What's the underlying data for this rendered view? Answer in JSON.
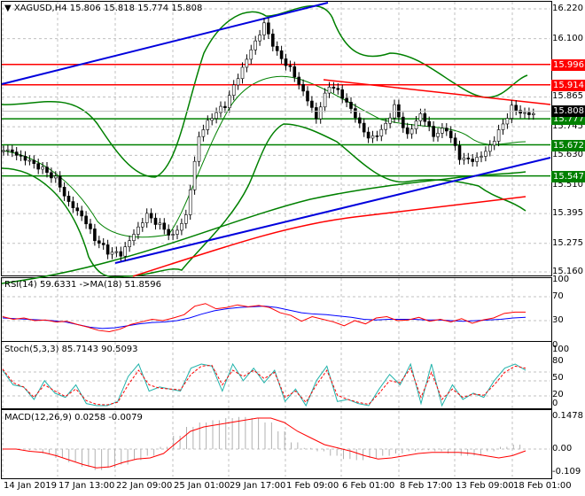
{
  "header": {
    "symbol": "XAGUSD,H4",
    "open": "15.806",
    "high": "15.818",
    "low": "15.774",
    "close": "15.808"
  },
  "price_axis": [
    "16.220",
    "16.100",
    "15.865",
    "15.745",
    "15.630",
    "15.510",
    "15.395",
    "15.275",
    "15.160"
  ],
  "levels": [
    {
      "label": "15.996",
      "price": 15.996,
      "color": "#ff0000"
    },
    {
      "label": "15.914",
      "price": 15.914,
      "color": "#ff0000"
    },
    {
      "label": "15.777",
      "price": 15.777,
      "color": "#008000"
    },
    {
      "label": "15.672",
      "price": 15.672,
      "color": "#008000"
    },
    {
      "label": "15.547",
      "price": 15.547,
      "color": "#008000"
    }
  ],
  "current_price": "15.808",
  "closes": [
    15.649,
    15.62,
    15.595,
    15.57,
    15.542,
    15.45,
    15.399,
    15.3,
    15.239,
    15.221,
    15.3,
    15.381,
    15.346,
    15.31,
    15.399,
    15.72,
    15.792,
    15.827,
    15.934,
    16.042,
    16.149,
    16.042,
    15.988,
    15.899,
    15.792,
    15.917,
    15.863,
    15.774,
    15.685,
    15.72,
    15.827,
    15.72,
    15.81,
    15.72,
    15.738,
    15.613,
    15.595,
    15.631,
    15.72,
    15.827,
    15.808
  ],
  "rsi": {
    "title": "RSI(14) 59.6331  ->MA(18) 51.8596",
    "axis": [
      "100",
      "70",
      "30",
      "0"
    ],
    "rsi": [
      52,
      48,
      50,
      46,
      47,
      44,
      45,
      40,
      36,
      31,
      29,
      33,
      40,
      44,
      48,
      46,
      50,
      55,
      68,
      72,
      64,
      66,
      70,
      67,
      69,
      66,
      58,
      54,
      45,
      52,
      48,
      44,
      38,
      46,
      41,
      50,
      52,
      46,
      47,
      51,
      45,
      48,
      44,
      49,
      42,
      47,
      50,
      57,
      59,
      59
    ],
    "ma": [
      50,
      49,
      48,
      47,
      46,
      44,
      40,
      36,
      34,
      35,
      38,
      41,
      43,
      44,
      46,
      50,
      56,
      61,
      64,
      66,
      67,
      68,
      66,
      62,
      58,
      56,
      55,
      53,
      51,
      48,
      47,
      48,
      48,
      48,
      47,
      47,
      46,
      45,
      46,
      47,
      48,
      50,
      51
    ]
  },
  "stoch": {
    "title": "Stoch(5,3,3) 85.7143 90.5093",
    "axis": [
      "100",
      "80",
      "50",
      "20",
      "0"
    ],
    "k": [
      85,
      50,
      45,
      15,
      60,
      30,
      20,
      50,
      5,
      0,
      0,
      10,
      70,
      100,
      35,
      45,
      40,
      35,
      90,
      100,
      95,
      35,
      100,
      60,
      90,
      55,
      85,
      10,
      40,
      0,
      60,
      95,
      10,
      15,
      5,
      0,
      40,
      75,
      50,
      100,
      5,
      100,
      0,
      50,
      15,
      30,
      20,
      60,
      90,
      100,
      85
    ],
    "d": [
      88,
      55,
      45,
      20,
      50,
      35,
      22,
      40,
      12,
      3,
      2,
      8,
      50,
      85,
      50,
      42,
      40,
      38,
      75,
      95,
      97,
      50,
      85,
      70,
      85,
      65,
      80,
      20,
      35,
      8,
      50,
      85,
      25,
      15,
      8,
      3,
      30,
      60,
      55,
      90,
      20,
      80,
      15,
      40,
      20,
      28,
      25,
      50,
      80,
      95,
      90
    ]
  },
  "macd": {
    "title": "MACD(12,26,9) 0.0258 -0.0079",
    "axis": [
      "0.1478",
      "0.00",
      "-0.109"
    ],
    "hist": [
      0,
      0,
      -0.005,
      -0.02,
      -0.04,
      -0.06,
      -0.08,
      -0.095,
      -0.085,
      -0.07,
      -0.05,
      -0.03,
      0.01,
      0.06,
      0.1,
      0.12,
      0.13,
      0.14,
      0.145,
      0.14,
      0.12,
      0.08,
      0.03,
      0.005,
      -0.01,
      -0.03,
      -0.045,
      -0.05,
      -0.04,
      -0.03,
      -0.02,
      -0.01,
      -0.005,
      -0.01,
      -0.02,
      -0.03,
      -0.03,
      -0.01,
      0.01,
      0.02
    ],
    "signal": [
      0,
      0,
      -0.01,
      -0.015,
      -0.03,
      -0.05,
      -0.07,
      -0.085,
      -0.08,
      -0.06,
      -0.045,
      -0.04,
      -0.02,
      0.03,
      0.08,
      0.1,
      0.11,
      0.12,
      0.13,
      0.14,
      0.14,
      0.12,
      0.08,
      0.05,
      0.02,
      0.005,
      -0.01,
      -0.03,
      -0.045,
      -0.04,
      -0.03,
      -0.02,
      -0.015,
      -0.015,
      -0.015,
      -0.02,
      -0.03,
      -0.04,
      -0.03,
      -0.008
    ]
  },
  "time_axis": [
    "14 Jan 2019",
    "17 Jan 13:00",
    "22 Jan 09:00",
    "25 Jan 01:00",
    "29 Jan 17:00",
    "1 Feb 09:00",
    "6 Feb 01:00",
    "8 Feb 17:00",
    "13 Feb 09:00",
    "18 Feb 01:00"
  ]
}
